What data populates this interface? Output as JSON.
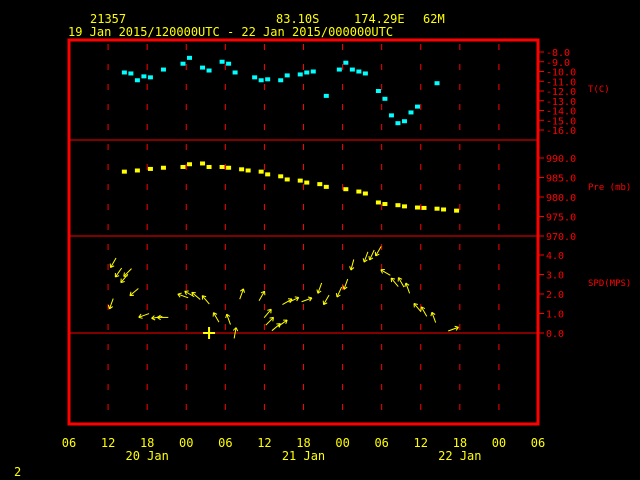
{
  "header": {
    "station_id": "21357",
    "latitude": "83.10S",
    "longitude": "174.29E",
    "elevation": "62M",
    "period": "19 Jan 2015/120000UTC - 22 Jan 2015/000000UTC"
  },
  "page_number": "2",
  "colors": {
    "frame": "#ff0000",
    "grid": "#ff0000",
    "temperature": "#00ffff",
    "pressure": "#ffff00",
    "wind": "#ffff00",
    "axis_text": "#ffff00",
    "panel_text": "#ff0000",
    "background": "#000000"
  },
  "x_axis": {
    "hour_labels": [
      "06",
      "12",
      "18",
      "00",
      "06",
      "12",
      "18",
      "00",
      "06",
      "12",
      "18",
      "00",
      "06"
    ],
    "day_labels": [
      {
        "at_hour": 18,
        "text": "20 Jan"
      },
      {
        "at_hour": 42,
        "text": "21 Jan"
      },
      {
        "at_hour": 66,
        "text": "22 Jan"
      }
    ]
  },
  "chart_data": [
    {
      "type": "scatter",
      "ylabel": "T(C)",
      "ylim": [
        -16,
        -8
      ],
      "y_ticks": [
        "-8.0",
        "-9.0",
        "-10.0",
        "-11.0",
        "-12.0",
        "-13.0",
        "-14.0",
        "-15.0",
        "-16.0"
      ],
      "y_tick_values": [
        -8,
        -9,
        -10,
        -11,
        -12,
        -13,
        -14,
        -15,
        -16
      ],
      "x_hours": [
        14.5,
        15.5,
        16.5,
        17.5,
        18.5,
        20.5,
        23.5,
        24.5,
        26.5,
        27.5,
        29.5,
        30.5,
        31.5,
        34.5,
        35.5,
        36.5,
        38.5,
        39.5,
        41.5,
        42.5,
        43.5,
        45.5,
        47.5,
        48.5,
        49.5,
        50.5,
        51.5,
        53.5,
        54.5,
        55.5,
        56.5,
        57.5,
        58.5,
        59.5,
        62.5
      ],
      "values": [
        -10.1,
        -10.2,
        -10.9,
        -10.5,
        -10.6,
        -9.8,
        -9.2,
        -8.6,
        -9.6,
        -9.9,
        -9.0,
        -9.2,
        -10.1,
        -10.6,
        -10.9,
        -10.8,
        -10.9,
        -10.4,
        -10.3,
        -10.1,
        -10.0,
        -12.5,
        -9.8,
        -9.1,
        -9.8,
        -10.0,
        -10.2,
        -12.0,
        -12.8,
        -14.5,
        -15.3,
        -15.1,
        -14.2,
        -13.6,
        -11.2
      ]
    },
    {
      "type": "scatter",
      "ylabel": "Pre (mb)",
      "ylim": [
        970,
        992.5
      ],
      "y_ticks": [
        "990.0",
        "985.0",
        "980.0",
        "975.0",
        "970.0"
      ],
      "y_tick_values": [
        990,
        985,
        980,
        975,
        970
      ],
      "x_hours": [
        14.5,
        16.5,
        18.5,
        20.5,
        23.5,
        24.5,
        26.5,
        27.5,
        29.5,
        30.5,
        32.5,
        33.5,
        35.5,
        36.5,
        38.5,
        39.5,
        41.5,
        42.5,
        44.5,
        45.5,
        48.5,
        50.5,
        51.5,
        53.5,
        54.5,
        56.5,
        57.5,
        59.5,
        60.5,
        62.5,
        63.5,
        65.5
      ],
      "values": [
        986.5,
        986.8,
        987.2,
        987.5,
        987.7,
        988.4,
        988.6,
        987.7,
        987.7,
        987.5,
        987.1,
        986.8,
        986.5,
        985.8,
        985.3,
        984.5,
        984.2,
        983.7,
        983.3,
        982.6,
        982.0,
        981.4,
        980.9,
        978.6,
        978.2,
        977.9,
        977.6,
        977.3,
        977.2,
        977.0,
        976.8,
        976.5
      ]
    },
    {
      "type": "scatter",
      "ylabel": "SPD(MPS)",
      "ylim": [
        -0.3,
        4.5
      ],
      "y_ticks": [
        "4.0",
        "3.0",
        "2.0",
        "1.0",
        "0.0"
      ],
      "y_tick_values": [
        4,
        3,
        2,
        1,
        0
      ],
      "x_hours": [
        12.5,
        12.8,
        13.6,
        14.5,
        15.0,
        16.0,
        17.5,
        19.5,
        20.4,
        23.5,
        24.5,
        25.5,
        27.0,
        28.6,
        30.5,
        31.5,
        32.5,
        35.6,
        36.5,
        36.8,
        37.8,
        38.8,
        39.5,
        40.5,
        42.5,
        44.5,
        45.5,
        47.5,
        48.5,
        49.5,
        51.6,
        52.5,
        53.5,
        54.6,
        56.0,
        57.0,
        58.0,
        59.5,
        60.5,
        62.0,
        65.0
      ],
      "values": [
        1.5,
        3.6,
        3.1,
        2.8,
        3.1,
        2.1,
        0.9,
        0.8,
        0.8,
        1.9,
        2.0,
        1.9,
        1.7,
        0.8,
        0.7,
        0.0,
        2.0,
        1.9,
        1.0,
        0.6,
        0.3,
        0.5,
        1.6,
        1.7,
        1.7,
        2.3,
        1.7,
        2.1,
        2.5,
        3.5,
        3.9,
        4.0,
        4.2,
        3.1,
        2.6,
        2.6,
        2.3,
        1.3,
        1.1,
        0.8,
        0.2
      ],
      "directions_deg": [
        200,
        210,
        215,
        220,
        225,
        230,
        250,
        260,
        270,
        290,
        300,
        310,
        320,
        330,
        340,
        10,
        20,
        30,
        40,
        45,
        50,
        55,
        60,
        65,
        70,
        200,
        210,
        205,
        200,
        195,
        200,
        205,
        210,
        300,
        320,
        330,
        340,
        320,
        330,
        340,
        70
      ]
    }
  ]
}
